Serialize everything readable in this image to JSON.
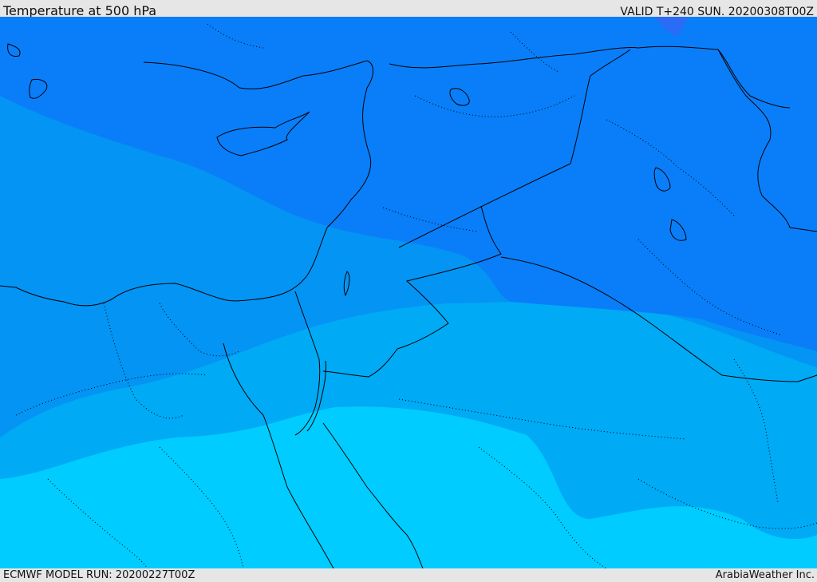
{
  "header": {
    "title": "Temperature at 500 hPa",
    "valid": "VALID T+240 SUN. 20200308T00Z"
  },
  "footer": {
    "model_run": "ECMWF MODEL RUN: 20200227T00Z",
    "credit": "ArabiaWeather Inc."
  },
  "colors": {
    "band_darkest": "#2a6cf6",
    "band_dark": "#0a7ef8",
    "band_mid": "#0494f4",
    "band_light": "#00aaf5",
    "band_lightest": "#00ccff",
    "coastline": "#000000"
  }
}
